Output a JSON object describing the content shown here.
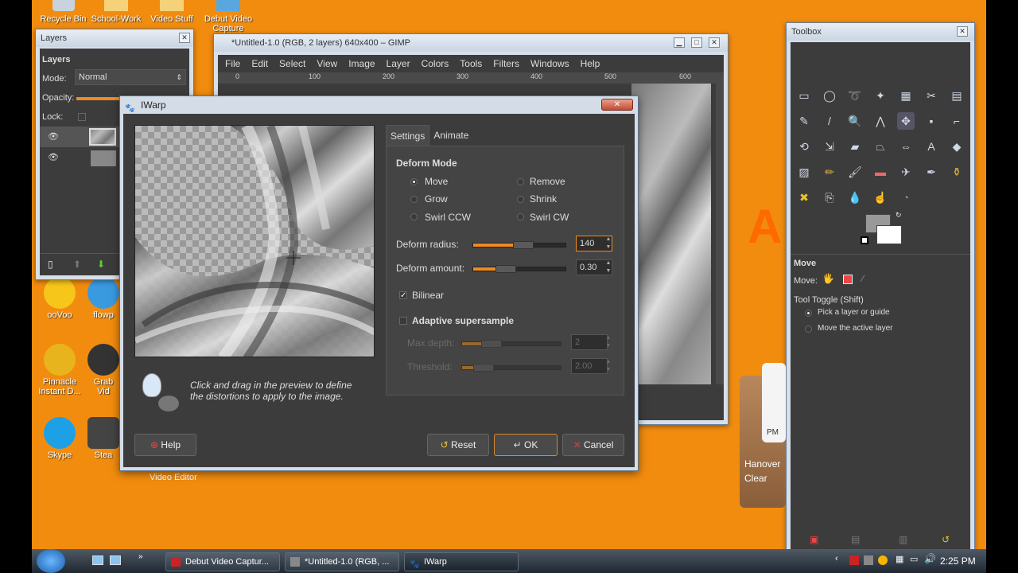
{
  "desktop": {
    "top_icons": [
      "Recycle Bin",
      "School-Work",
      "Video Stuff",
      "Debut Video"
    ],
    "top_icon_partial": "Capture",
    "left_icons": [
      {
        "label": "ooVoo"
      },
      {
        "label": "flowp"
      },
      {
        "label_1": "Pinnacle",
        "label_2": "Instant D..."
      },
      {
        "label_1": "Grab",
        "label_2": "Vid"
      },
      {
        "label": "Skype"
      },
      {
        "label": "Stea"
      }
    ],
    "video_editor_label": "Video Editor"
  },
  "layers_window": {
    "title": "Layers",
    "panel_title": "Layers",
    "mode_label": "Mode:",
    "mode_value": "Normal",
    "opacity_label": "Opacity:",
    "lock_label": "Lock:"
  },
  "gimp_window": {
    "title": "*Untitled-1.0 (RGB, 2 layers) 640x400 – GIMP",
    "menus": [
      "File",
      "Edit",
      "Select",
      "View",
      "Image",
      "Layer",
      "Colors",
      "Tools",
      "Filters",
      "Windows",
      "Help"
    ],
    "ruler_ticks": [
      "0",
      "100",
      "200",
      "300",
      "400",
      "500",
      "600"
    ]
  },
  "iwarp": {
    "title": "IWarp",
    "tabs": [
      "Settings",
      "Animate"
    ],
    "deform_mode_label": "Deform Mode",
    "modes": [
      "Move",
      "Remove",
      "Grow",
      "Shrink",
      "Swirl CCW",
      "Swirl CW"
    ],
    "selected_mode": "Move",
    "deform_radius_label": "Deform radius:",
    "deform_radius_value": "140",
    "deform_amount_label": "Deform amount:",
    "deform_amount_value": "0.30",
    "bilinear_label": "Bilinear",
    "bilinear_checked": true,
    "adaptive_label": "Adaptive supersample",
    "adaptive_checked": false,
    "max_depth_label": "Max depth:",
    "max_depth_value": "2",
    "threshold_label": "Threshold:",
    "threshold_value": "2.00",
    "hint_line1": "Click and drag in the preview to define",
    "hint_line2": "the distortions to apply to the image.",
    "buttons": {
      "help": "Help",
      "reset": "Reset",
      "ok": "OK",
      "cancel": "Cancel"
    }
  },
  "toolbox": {
    "title": "Toolbox",
    "options_title": "Move",
    "move_label": "Move:",
    "tool_toggle_label": "Tool Toggle  (Shift)",
    "option_pick": "Pick a layer or guide",
    "option_move_active": "Move the active layer"
  },
  "gadget": {
    "pm": "PM",
    "city": "Hanover",
    "weather": "Clear"
  },
  "taskbar": {
    "items": [
      "Debut Video Captur...",
      "*Untitled-1.0 (RGB, ...",
      "IWarp"
    ],
    "clock": "2:25 PM"
  }
}
